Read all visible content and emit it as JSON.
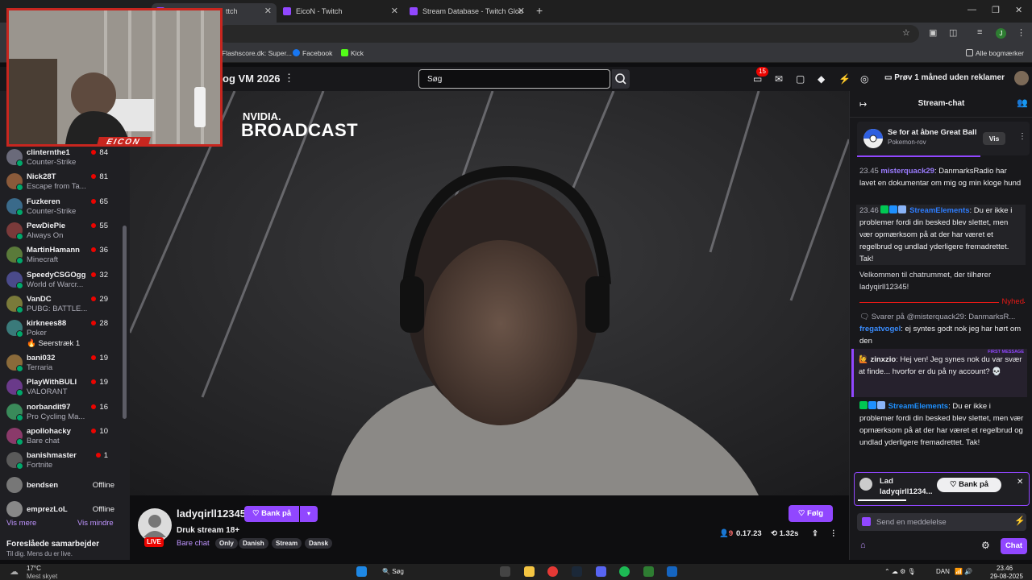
{
  "browser": {
    "tabs": [
      {
        "title": "ttch",
        "active": true
      },
      {
        "title": "EicoN - Twitch",
        "active": false
      },
      {
        "title": "Stream Database - Twitch Glob",
        "active": false
      }
    ],
    "bookmarks": [
      "Flashscore.dk: Super...",
      "Facebook",
      "Kick"
    ],
    "all_bookmarks": "Alle bogmærker",
    "profile_initial": "J"
  },
  "overlay": {
    "cam_label": "EICON"
  },
  "topnav": {
    "stream_title_partial": "og VM 2026",
    "search_placeholder": "Søg",
    "notif_count": "15",
    "prime_cta": "Prøv 1 måned uden reklamer"
  },
  "sidebar": {
    "channels": [
      {
        "name": "clinternthe1",
        "game": "Counter-Strike",
        "viewers": "84"
      },
      {
        "name": "Nick28T",
        "game": "Escape from Ta...",
        "viewers": "81"
      },
      {
        "name": "Fuzkeren",
        "game": "Counter-Strike",
        "viewers": "65"
      },
      {
        "name": "PewDiePie",
        "game": "Always On",
        "viewers": "55"
      },
      {
        "name": "MartinHamann",
        "game": "Minecraft",
        "viewers": "36"
      },
      {
        "name": "SpeedyCSGOgg",
        "game": "World of Warcr...",
        "viewers": "32"
      },
      {
        "name": "VanDC",
        "game": "PUBG: BATTLE...",
        "viewers": "29"
      },
      {
        "name": "kirknees88",
        "game": "Poker",
        "viewers": "28",
        "sub": "Seerstræk 1"
      },
      {
        "name": "bani032",
        "game": "Terraria",
        "viewers": "19"
      },
      {
        "name": "PlayWithBULI",
        "game": "VALORANT",
        "viewers": "19"
      },
      {
        "name": "norbandit97",
        "game": "Pro Cycling Ma...",
        "viewers": "16"
      },
      {
        "name": "apollohacky",
        "game": "Bare chat",
        "viewers": "10"
      },
      {
        "name": "banishmaster",
        "game": "Fortnite",
        "viewers": "1"
      },
      {
        "name": "bendsen",
        "game": "",
        "viewers": "Offline"
      },
      {
        "name": "emprezLoL",
        "game": "",
        "viewers": "Offline"
      }
    ],
    "show_more": "Vis mere",
    "show_less": "Vis mindre",
    "recommended_title": "Foreslåede samarbejder",
    "recommended_sub": "Til dig. Mens du er live."
  },
  "player": {
    "nvidia": "NVIDIA.",
    "broadcast": "BROADCAST"
  },
  "info": {
    "channel_name": "ladyqirll12345",
    "knock": "Bank på",
    "follow": "Følg",
    "title": "Druk stream 18+",
    "category": "Bare chat",
    "tags": [
      "Only",
      "Danish",
      "Stream",
      "Dansk"
    ],
    "viewers": "9",
    "uptime": "0.17.23",
    "count": "1.32s",
    "live": "LIVE"
  },
  "chat": {
    "title": "Stream-chat",
    "prediction": {
      "title": "Se for at åbne Great Ball",
      "sub": "Pokemon-rov",
      "button": "Vis"
    },
    "messages": [
      {
        "time": "23.45",
        "user": "misterquack29",
        "text": ": DanmarksRadio har lavet en dokumentar om mig og min kloge hund"
      },
      {
        "time": "23.46",
        "user": "StreamElements",
        "text": ": Du er ikke i problemer fordi din besked blev slettet, men vær opmærksom på at der har været et regelbrud og undlad yderligere fremadrettet. Tak!"
      },
      {
        "time": "",
        "user": "",
        "text": "Velkommen til chatrummet, der tilhører ladyqirll12345!"
      }
    ],
    "new_label": "Nyhed",
    "reply_prefix": "Svarer på @misterquack29: DanmarksR...",
    "reply_user": "fregatvogel",
    "reply_text": ": ej syntes godt nok jeg har hørt om den",
    "first_label": "FIRST MESSAGE",
    "first_user": "zinxzio",
    "first_text": ": Hej ven! Jeg synes nok du var svær at finde... hvorfor er du på ny account?",
    "se_user": "StreamElements",
    "se_text": ": Du er ikke i problemer fordi din besked blev slettet, men vær opmærksom på at der har været et regelbrud og undlad yderligere fremadrettet. Tak!",
    "pin": {
      "title": "Lad",
      "name": "ladyqirll1234...",
      "button": "Bank på"
    },
    "send_placeholder": "Send en meddelelse",
    "chat_button": "Chat"
  },
  "taskbar": {
    "weather_temp": "17°C",
    "weather_desc": "Mest skyet",
    "search": "Søg",
    "lang": "DAN",
    "time": "23.46",
    "date": "29-08-2025"
  }
}
